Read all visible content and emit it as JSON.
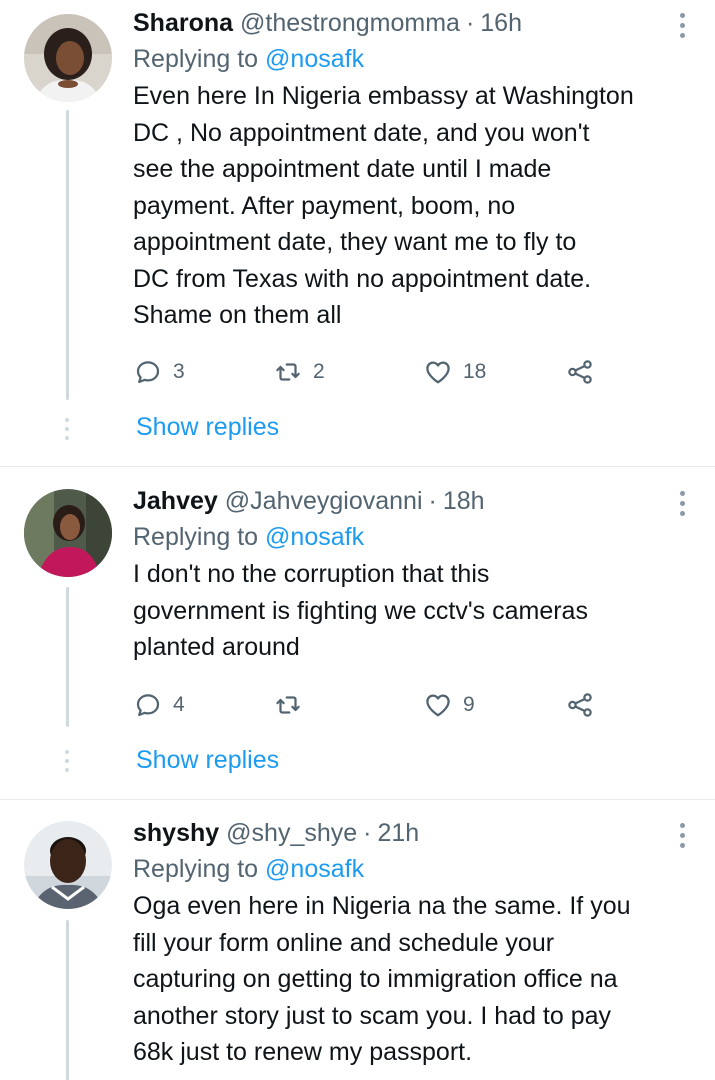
{
  "tweets": [
    {
      "name": "Sharona",
      "handle": "@thestrongmomma",
      "separator": "·",
      "time": "16h",
      "replying_label": "Replying to",
      "replying_handle": "@nosafk",
      "text": "Even here In Nigeria embassy at Washington\nDC ,  No appointment date, and you won't\nsee the appointment date until I made\npayment.  After payment,  boom, no\nappointment date,  they want me to fly to\nDC from Texas with no appointment date.\nShame on them all",
      "reply_count": "3",
      "retweet_count": "2",
      "like_count": "18",
      "show_replies": "Show replies"
    },
    {
      "name": "Jahvey",
      "handle": "@Jahveygiovanni",
      "separator": "·",
      "time": "18h",
      "replying_label": "Replying to",
      "replying_handle": "@nosafk",
      "text": "I don't no the corruption that this\ngovernment is fighting we cctv's cameras\nplanted around",
      "reply_count": "4",
      "retweet_count": "",
      "like_count": "9",
      "show_replies": "Show replies"
    },
    {
      "name": "shyshy",
      "handle": "@shy_shye",
      "separator": "·",
      "time": "21h",
      "replying_label": "Replying to",
      "replying_handle": "@nosafk",
      "text": "Oga even here in Nigeria  na the same. If you\nfill your form online and schedule your\ncapturing on getting to immigration office na\nanother story just to scam you. I had to pay\n68k just to renew my passport.",
      "reply_count": "",
      "retweet_count": "",
      "like_count": "",
      "show_replies": ""
    }
  ],
  "icons": {
    "reply": "reply-icon",
    "retweet": "retweet-icon",
    "like": "heart-icon",
    "share": "share-icon",
    "more": "more-options-icon"
  },
  "colors": {
    "accent": "#1d9bf0",
    "secondary_text": "#536471",
    "divider": "#e6ecf0",
    "thread_line": "#cfd9de"
  }
}
